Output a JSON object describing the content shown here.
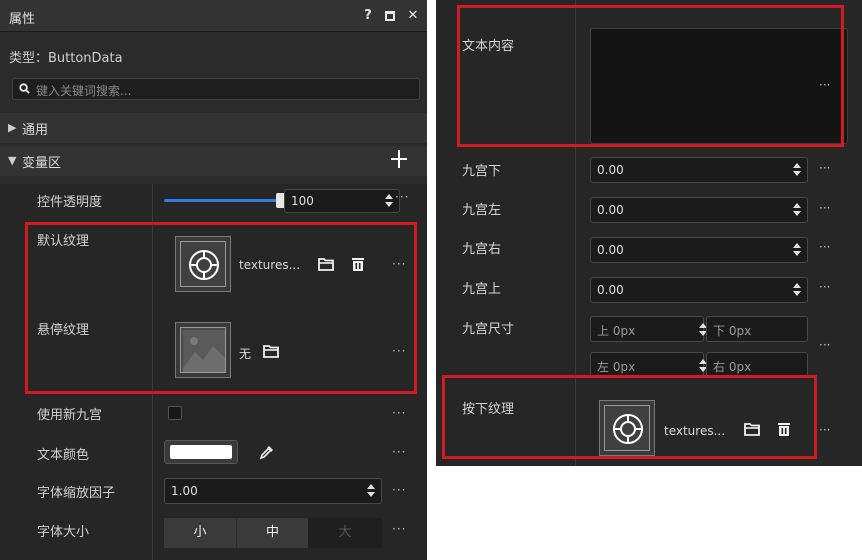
{
  "left_panel": {
    "title": "属性",
    "help": "?",
    "close": "✕",
    "type_label": "类型：ButtonData",
    "search_placeholder": "键入关键词搜索...",
    "section_general": "通用",
    "section_variables": "变量区",
    "props": {
      "opacity_label": "控件透明度",
      "opacity_value": "100",
      "opacity_level": 1.0,
      "default_texture_label": "默认纹理",
      "default_texture_name": "textures...",
      "hover_texture_label": "悬停纹理",
      "hover_texture_name": "无",
      "use_nine_label": "使用新九宫",
      "text_color_label": "文本颜色",
      "text_color": "#ffffff",
      "font_scale_label": "字体缩放因子",
      "font_scale_value": "1.00",
      "font_size_label": "字体大小",
      "font_size_small": "小",
      "font_size_medium": "中",
      "font_size_large": "大",
      "more": "···"
    }
  },
  "right_panel": {
    "text_content_label": "文本内容",
    "nine_bottom_label": "九宫下",
    "nine_bottom_value": "0.00",
    "nine_left_label": "九宫左",
    "nine_left_value": "0.00",
    "nine_right_label": "九宫右",
    "nine_right_value": "0.00",
    "nine_top_label": "九宫上",
    "nine_top_value": "0.00",
    "nine_size_label": "九宫尺寸",
    "pad_top": "上 0px",
    "pad_bottom": "下 0px",
    "pad_left": "左 0px",
    "pad_right": "右 0px",
    "pressed_texture_label": "按下纹理",
    "pressed_texture_name": "textures...",
    "more": "···"
  },
  "colors": {
    "highlight": "#d11b22",
    "accent": "#2f7fe0"
  }
}
